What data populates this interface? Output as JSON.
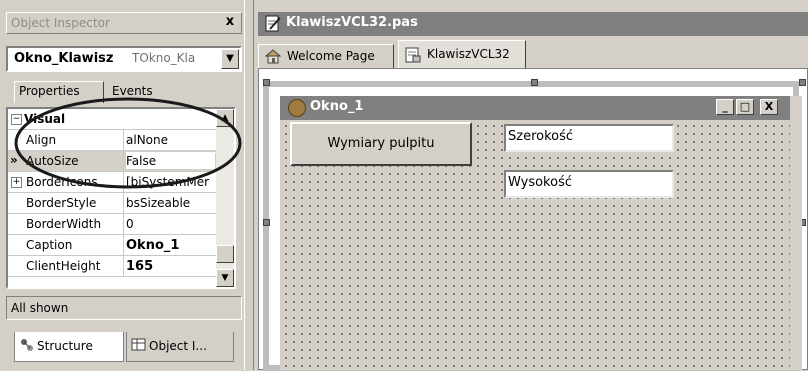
{
  "object_inspector": {
    "title": "Object Inspector",
    "close_symbol": "x",
    "component_name": "Okno_Klawisz",
    "component_type": "TOkno_Kla",
    "tabs": [
      "Properties",
      "Events"
    ],
    "properties": [
      {
        "name": "Visual",
        "value": "",
        "section": true,
        "expand": "−"
      },
      {
        "name": "Align",
        "value": "alNone"
      },
      {
        "name": "AutoSize",
        "value": "False",
        "selected": true,
        "marker": "»"
      },
      {
        "name": "BorderIcons",
        "value": "[biSystemMer",
        "expand": "+"
      },
      {
        "name": "BorderStyle",
        "value": "bsSizeable"
      },
      {
        "name": "BorderWidth",
        "value": "0"
      },
      {
        "name": "Caption",
        "value": "Okno_1",
        "bold": true
      },
      {
        "name": "ClientHeight",
        "value": "165",
        "bold": true
      }
    ],
    "status": "All shown",
    "bottom_tabs": [
      "Structure",
      "Object I..."
    ]
  },
  "editor": {
    "title": "KlawiszVCL32.pas",
    "tabs": [
      "Welcome Page",
      "KlawiszVCL32"
    ],
    "active_tab": "KlawiszVCL32"
  },
  "form": {
    "title": "Okno_1",
    "button_label": "Wymiary pulpitu",
    "edit1_text": "Szerokość",
    "edit2_text": "Wysokość",
    "controls": [
      "_",
      "□",
      "X"
    ]
  },
  "icons": {
    "inspector_close": "close-icon",
    "editor_file": "pas-file-icon",
    "welcome": "home-icon",
    "unit": "unit-file-icon",
    "structure": "structure-icon",
    "object_inspector": "object-inspector-icon"
  },
  "colors": {
    "title_inactive": "#808080",
    "face": "#d4d0c8",
    "annotation": "#1a1a1a"
  }
}
